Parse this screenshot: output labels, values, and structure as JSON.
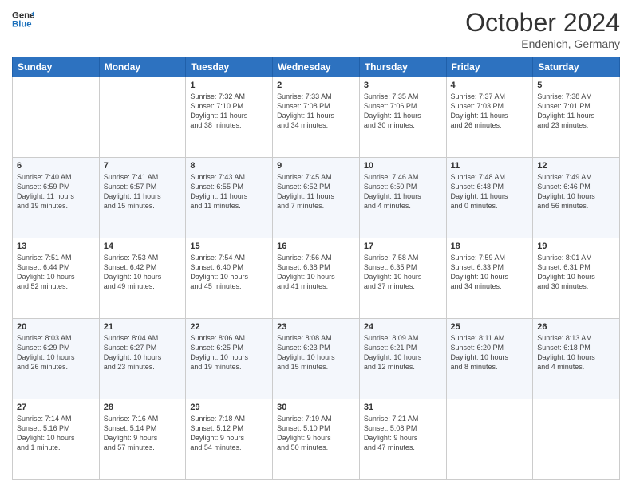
{
  "header": {
    "logo_line1": "General",
    "logo_line2": "Blue",
    "month": "October 2024",
    "location": "Endenich, Germany"
  },
  "weekdays": [
    "Sunday",
    "Monday",
    "Tuesday",
    "Wednesday",
    "Thursday",
    "Friday",
    "Saturday"
  ],
  "weeks": [
    [
      {
        "day": "",
        "info": ""
      },
      {
        "day": "",
        "info": ""
      },
      {
        "day": "1",
        "info": "Sunrise: 7:32 AM\nSunset: 7:10 PM\nDaylight: 11 hours\nand 38 minutes."
      },
      {
        "day": "2",
        "info": "Sunrise: 7:33 AM\nSunset: 7:08 PM\nDaylight: 11 hours\nand 34 minutes."
      },
      {
        "day": "3",
        "info": "Sunrise: 7:35 AM\nSunset: 7:06 PM\nDaylight: 11 hours\nand 30 minutes."
      },
      {
        "day": "4",
        "info": "Sunrise: 7:37 AM\nSunset: 7:03 PM\nDaylight: 11 hours\nand 26 minutes."
      },
      {
        "day": "5",
        "info": "Sunrise: 7:38 AM\nSunset: 7:01 PM\nDaylight: 11 hours\nand 23 minutes."
      }
    ],
    [
      {
        "day": "6",
        "info": "Sunrise: 7:40 AM\nSunset: 6:59 PM\nDaylight: 11 hours\nand 19 minutes."
      },
      {
        "day": "7",
        "info": "Sunrise: 7:41 AM\nSunset: 6:57 PM\nDaylight: 11 hours\nand 15 minutes."
      },
      {
        "day": "8",
        "info": "Sunrise: 7:43 AM\nSunset: 6:55 PM\nDaylight: 11 hours\nand 11 minutes."
      },
      {
        "day": "9",
        "info": "Sunrise: 7:45 AM\nSunset: 6:52 PM\nDaylight: 11 hours\nand 7 minutes."
      },
      {
        "day": "10",
        "info": "Sunrise: 7:46 AM\nSunset: 6:50 PM\nDaylight: 11 hours\nand 4 minutes."
      },
      {
        "day": "11",
        "info": "Sunrise: 7:48 AM\nSunset: 6:48 PM\nDaylight: 11 hours\nand 0 minutes."
      },
      {
        "day": "12",
        "info": "Sunrise: 7:49 AM\nSunset: 6:46 PM\nDaylight: 10 hours\nand 56 minutes."
      }
    ],
    [
      {
        "day": "13",
        "info": "Sunrise: 7:51 AM\nSunset: 6:44 PM\nDaylight: 10 hours\nand 52 minutes."
      },
      {
        "day": "14",
        "info": "Sunrise: 7:53 AM\nSunset: 6:42 PM\nDaylight: 10 hours\nand 49 minutes."
      },
      {
        "day": "15",
        "info": "Sunrise: 7:54 AM\nSunset: 6:40 PM\nDaylight: 10 hours\nand 45 minutes."
      },
      {
        "day": "16",
        "info": "Sunrise: 7:56 AM\nSunset: 6:38 PM\nDaylight: 10 hours\nand 41 minutes."
      },
      {
        "day": "17",
        "info": "Sunrise: 7:58 AM\nSunset: 6:35 PM\nDaylight: 10 hours\nand 37 minutes."
      },
      {
        "day": "18",
        "info": "Sunrise: 7:59 AM\nSunset: 6:33 PM\nDaylight: 10 hours\nand 34 minutes."
      },
      {
        "day": "19",
        "info": "Sunrise: 8:01 AM\nSunset: 6:31 PM\nDaylight: 10 hours\nand 30 minutes."
      }
    ],
    [
      {
        "day": "20",
        "info": "Sunrise: 8:03 AM\nSunset: 6:29 PM\nDaylight: 10 hours\nand 26 minutes."
      },
      {
        "day": "21",
        "info": "Sunrise: 8:04 AM\nSunset: 6:27 PM\nDaylight: 10 hours\nand 23 minutes."
      },
      {
        "day": "22",
        "info": "Sunrise: 8:06 AM\nSunset: 6:25 PM\nDaylight: 10 hours\nand 19 minutes."
      },
      {
        "day": "23",
        "info": "Sunrise: 8:08 AM\nSunset: 6:23 PM\nDaylight: 10 hours\nand 15 minutes."
      },
      {
        "day": "24",
        "info": "Sunrise: 8:09 AM\nSunset: 6:21 PM\nDaylight: 10 hours\nand 12 minutes."
      },
      {
        "day": "25",
        "info": "Sunrise: 8:11 AM\nSunset: 6:20 PM\nDaylight: 10 hours\nand 8 minutes."
      },
      {
        "day": "26",
        "info": "Sunrise: 8:13 AM\nSunset: 6:18 PM\nDaylight: 10 hours\nand 4 minutes."
      }
    ],
    [
      {
        "day": "27",
        "info": "Sunrise: 7:14 AM\nSunset: 5:16 PM\nDaylight: 10 hours\nand 1 minute."
      },
      {
        "day": "28",
        "info": "Sunrise: 7:16 AM\nSunset: 5:14 PM\nDaylight: 9 hours\nand 57 minutes."
      },
      {
        "day": "29",
        "info": "Sunrise: 7:18 AM\nSunset: 5:12 PM\nDaylight: 9 hours\nand 54 minutes."
      },
      {
        "day": "30",
        "info": "Sunrise: 7:19 AM\nSunset: 5:10 PM\nDaylight: 9 hours\nand 50 minutes."
      },
      {
        "day": "31",
        "info": "Sunrise: 7:21 AM\nSunset: 5:08 PM\nDaylight: 9 hours\nand 47 minutes."
      },
      {
        "day": "",
        "info": ""
      },
      {
        "day": "",
        "info": ""
      }
    ]
  ]
}
